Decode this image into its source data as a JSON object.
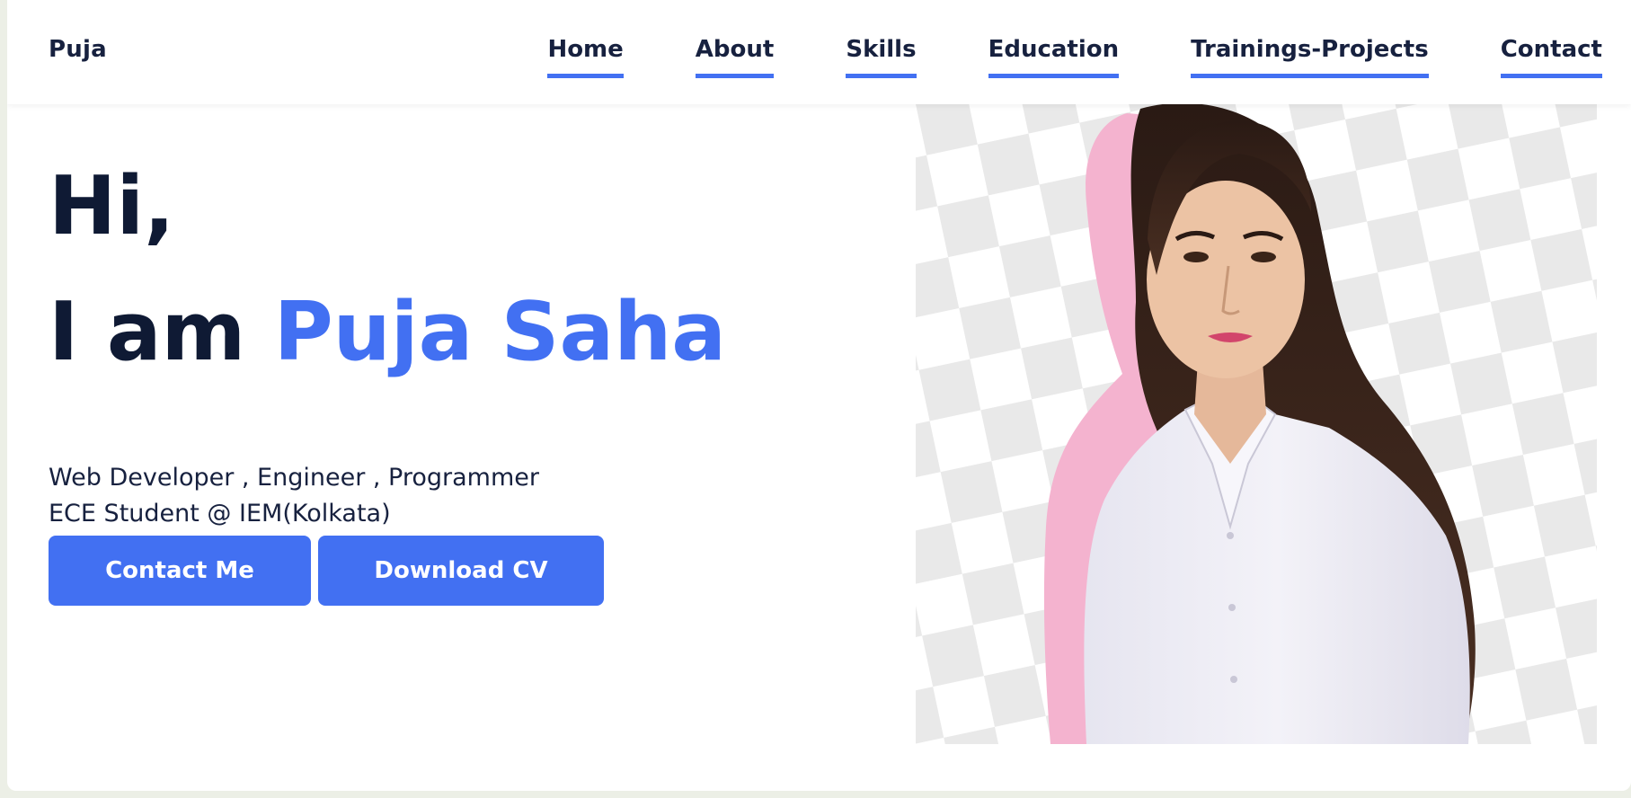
{
  "nav": {
    "brand": "Puja",
    "links": [
      {
        "label": "Home"
      },
      {
        "label": "About"
      },
      {
        "label": "Skills"
      },
      {
        "label": "Education"
      },
      {
        "label": "Trainings-Projects"
      },
      {
        "label": "Contact"
      }
    ]
  },
  "hero": {
    "greeting": "Hi,",
    "intro_prefix": "I am",
    "name": "Puja Saha",
    "tagline_line1": "Web Developer , Engineer , Programmer",
    "tagline_line2": "ECE Student @ IEM(Kolkata)",
    "contact_button": "Contact Me",
    "cv_button": "Download CV"
  },
  "colors": {
    "accent": "#4270f2",
    "text_dark": "#0f1a34",
    "nav_text": "#17213f",
    "photo_outline": "#f4b3cf"
  },
  "icons": {
    "profile_photo": "profile-photo"
  }
}
